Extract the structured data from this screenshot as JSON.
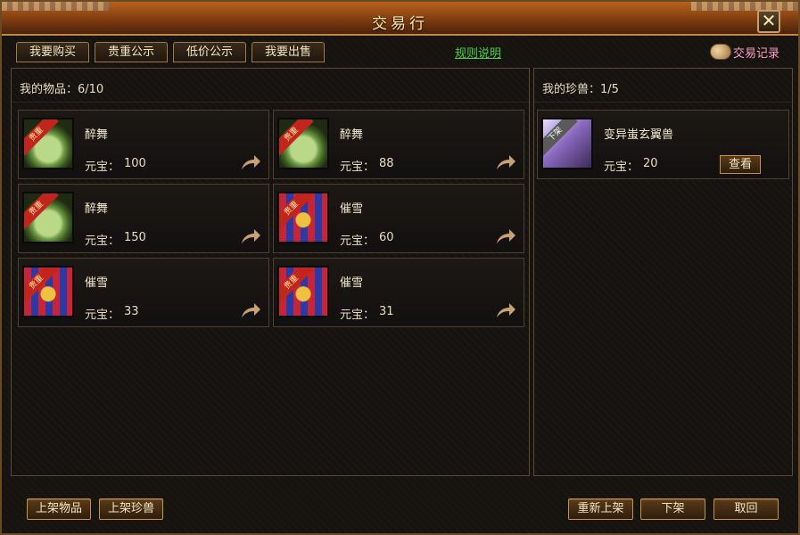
{
  "window": {
    "title": "交易行",
    "close_label": "✕"
  },
  "tabs": [
    "我要购买",
    "贵重公示",
    "低价公示",
    "我要出售"
  ],
  "rules_link": "规则说明",
  "trade_record": "交易记录",
  "items_panel": {
    "header": "我的物品：6/10",
    "price_label": "元宝：",
    "items": [
      {
        "name": "醉舞",
        "price": "100",
        "icon": "jade-pendant-icon",
        "badge": "贵重"
      },
      {
        "name": "醉舞",
        "price": "88",
        "icon": "jade-pendant-icon",
        "badge": "贵重"
      },
      {
        "name": "醉舞",
        "price": "150",
        "icon": "jade-pendant-icon",
        "badge": "贵重"
      },
      {
        "name": "催雪",
        "price": "60",
        "icon": "snow-armor-icon",
        "badge": "贵重"
      },
      {
        "name": "催雪",
        "price": "33",
        "icon": "snow-armor-icon",
        "badge": "贵重"
      },
      {
        "name": "催雪",
        "price": "31",
        "icon": "snow-armor-icon",
        "badge": "贵重"
      }
    ]
  },
  "pets_panel": {
    "header": "我的珍兽：1/5",
    "price_label": "元宝：",
    "pets": [
      {
        "name": "变异蚩玄翼兽",
        "price": "20",
        "badge": "下架",
        "view_label": "查看",
        "icon": "winged-beast-icon"
      }
    ]
  },
  "bottom_buttons": {
    "list_item": "上架物品",
    "list_pet": "上架珍兽",
    "relist": "重新上架",
    "delist": "下架",
    "cancel": "取回"
  },
  "colors": {
    "accent": "#c8923a",
    "link": "#4ccf3c",
    "record": "#ff9bc6",
    "ribbon": "#c2251c"
  }
}
